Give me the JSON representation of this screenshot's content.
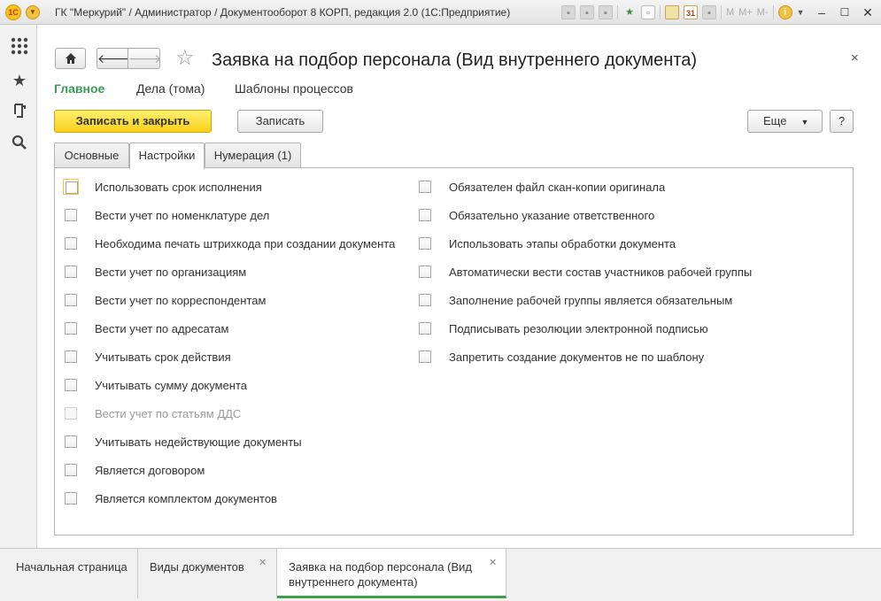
{
  "window": {
    "logo_text": "1С",
    "title": "ГК \"Меркурий\" / Администратор / Документооборот 8 КОРП, редакция 2.0  (1С:Предприятие)",
    "mem_buttons": [
      "M",
      "M+",
      "M-"
    ],
    "calendar_day": "31"
  },
  "left_panel": {
    "icons": [
      "apps-grid-icon",
      "favorites-star-icon",
      "history-icon",
      "search-icon"
    ]
  },
  "form": {
    "title": "Заявка на подбор персонала (Вид внутреннего документа)",
    "close_glyph": "×",
    "subnav": [
      "Главное",
      "Дела (тома)",
      "Шаблоны процессов"
    ],
    "buttons": {
      "save_close": "Записать и закрыть",
      "save": "Записать",
      "more": "Еще",
      "help": "?"
    },
    "tabs": [
      "Основные",
      "Настройки",
      "Нумерация (1)"
    ],
    "active_tab": "Настройки",
    "left_options": [
      {
        "label": "Использовать срок исполнения",
        "checked": false,
        "focused": true
      },
      {
        "label": "Вести учет по номенклатуре дел",
        "checked": false
      },
      {
        "label": "Необходима печать штрихкода при создании документа",
        "checked": false
      },
      {
        "label": "Вести учет по организациям",
        "checked": false
      },
      {
        "label": "Вести учет по корреспондентам",
        "checked": false
      },
      {
        "label": "Вести учет по адресатам",
        "checked": false
      },
      {
        "label": "Учитывать срок действия",
        "checked": false
      },
      {
        "label": "Учитывать сумму документа",
        "checked": false
      },
      {
        "label": "Вести учет по статьям ДДС",
        "checked": false,
        "disabled": true
      },
      {
        "label": "Учитывать недействующие документы",
        "checked": false
      },
      {
        "label": "Является договором",
        "checked": false
      },
      {
        "label": "Является комплектом документов",
        "checked": false
      }
    ],
    "right_options": [
      {
        "label": "Обязателен файл скан-копии оригинала",
        "checked": false
      },
      {
        "label": "Обязательно указание ответственного",
        "checked": false
      },
      {
        "label": "Использовать этапы обработки документа",
        "checked": false
      },
      {
        "label": "Автоматически вести состав участников рабочей группы",
        "checked": false
      },
      {
        "label": "Заполнение рабочей группы является обязательным",
        "checked": false
      },
      {
        "label": "Подписывать резолюции электронной подписью",
        "checked": false
      },
      {
        "label": "Запретить создание документов не по шаблону",
        "checked": false
      }
    ]
  },
  "open_windows": [
    {
      "label": "Начальная страница",
      "closable": false,
      "active": false
    },
    {
      "label": "Виды документов",
      "closable": true,
      "active": false
    },
    {
      "label": "Заявка на подбор персонала (Вид внутреннего документа)",
      "closable": true,
      "active": true
    }
  ],
  "colors": {
    "accent_green": "#3a9b5a",
    "primary_button": "#f9d019",
    "active_tab_underline": "#3aa04a"
  }
}
